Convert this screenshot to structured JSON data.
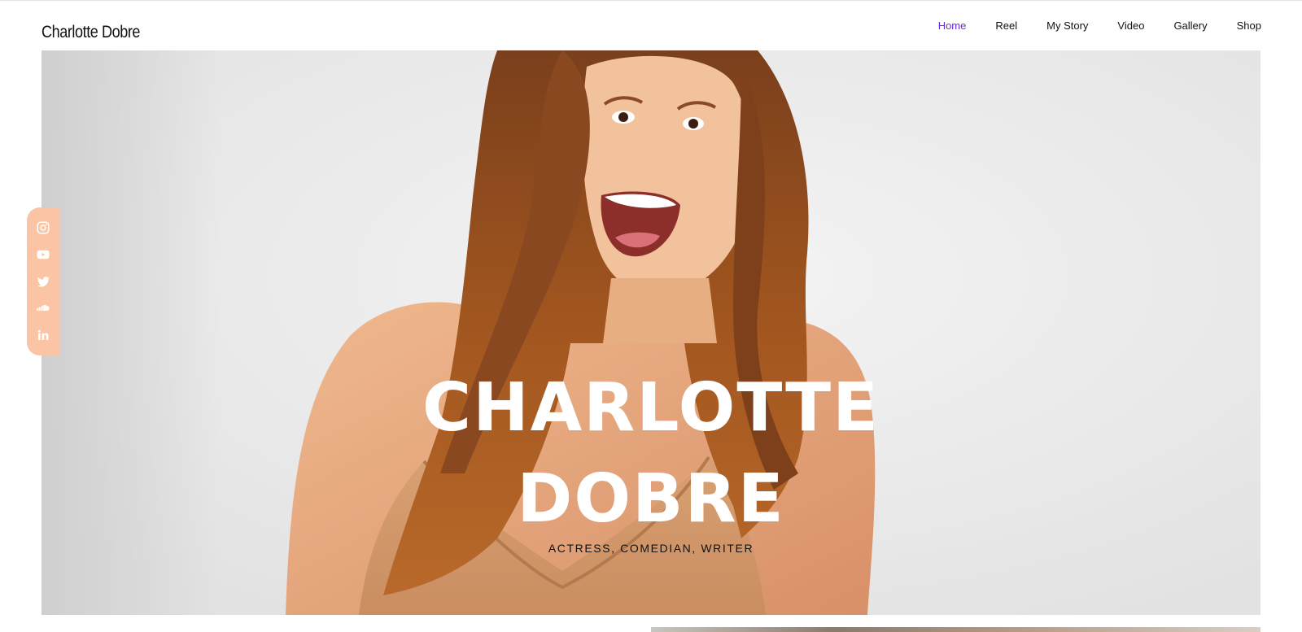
{
  "header": {
    "site_title": "Charlotte Dobre",
    "nav": [
      {
        "label": "Home",
        "active": true
      },
      {
        "label": "Reel",
        "active": false
      },
      {
        "label": "My Story",
        "active": false
      },
      {
        "label": "Video",
        "active": false
      },
      {
        "label": "Gallery",
        "active": false
      },
      {
        "label": "Shop",
        "active": false
      }
    ],
    "active_color": "#6a2bd6"
  },
  "hero": {
    "heading_line1": "CHARLOTTE",
    "heading_line2": "DOBRE",
    "subtitle": "ACTRESS, COMEDIAN, WRITER",
    "photo_description_icon": "portrait-photo"
  },
  "social": {
    "background_color": "#fbc4a4",
    "icons": [
      "instagram-icon",
      "youtube-icon",
      "twitter-icon",
      "soundcloud-icon",
      "linkedin-icon"
    ]
  }
}
